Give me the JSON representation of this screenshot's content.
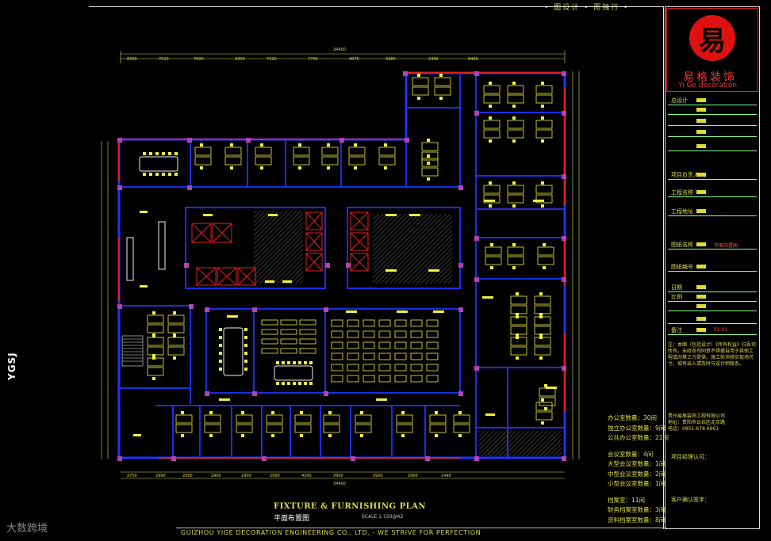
{
  "header": {
    "top_title": "• 图设计 • 而独行 •"
  },
  "logo": {
    "glyph": "易",
    "name_cn": "易格装饰",
    "name_en": "Yi Ge decoration"
  },
  "title_block": {
    "rows": [
      {
        "label": "总设计"
      },
      {
        "label": ""
      },
      {
        "label": ""
      },
      {
        "label": ""
      },
      {
        "label": ""
      },
      {
        "label": "项目负责人"
      },
      {
        "label": "工程名称"
      },
      {
        "label": "工程地址"
      },
      {
        "label": "图纸名称",
        "red": "平面布置图"
      },
      {
        "label": "图纸编号"
      },
      {
        "label": "日期"
      },
      {
        "label": "比例"
      },
      {
        "label": ""
      },
      {
        "label": ""
      },
      {
        "label": "备注",
        "red": "P1-01"
      }
    ],
    "notes": "注：本图（包括设计）《所有权益》归吾司所有。未经吾司同意不得擅自用于其他工程或向第三方提供。施工前须核实现场尺寸，如有出入请及时与设计师联系。",
    "company_lines": [
      "贵州易格装饰工程有限公司",
      "地址：贵阳市云岩区北京路",
      "电话：0851-678 6661"
    ],
    "sign1": "项目经理认可：",
    "sign2": "客户确认签字："
  },
  "stats": [
    "办公室数量：30间",
    "独立办公室数量：9间",
    "公共办公室数量：21间",
    "",
    "会议室数量：4间",
    "大型会议室数量：1间",
    "中型会议室数量：2间",
    "小型会议室数量：1间",
    "",
    "档案室：11间",
    "财务档案室数量：3间",
    "资料档案室数量：8间"
  ],
  "plan": {
    "title": "FIXTURE & FURNISHING PLAN",
    "subtitle": "平面布置图",
    "scale": "SCALE 1:150@A2",
    "footer": "GUIZHOU YIGE DECORATION ENGINEERING CO., LTD. - WE STRIVE FOR PERFECTION",
    "top_dims": [
      "8300",
      "7610",
      "7600",
      "4300",
      "7320",
      "7700",
      "4070",
      "6480",
      "2440",
      "6480"
    ],
    "total_dim": "34400",
    "bottom_dims": [
      "2750",
      "2900",
      "2900",
      "2900",
      "2900",
      "2900",
      "4300",
      "2900",
      "2900",
      "2900",
      "2440"
    ],
    "side_tag": "YGSJ"
  },
  "watermark": "大数跨境",
  "colors": {
    "wall_blue": "#1c34ff",
    "furniture_yellow": "#f0f040",
    "column_magenta": "#b044b0",
    "red_accent": "#e02020"
  }
}
